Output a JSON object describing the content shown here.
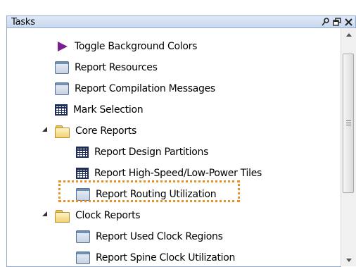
{
  "panel": {
    "title": "Tasks"
  },
  "header_buttons": {
    "pin": "⚲",
    "float": "🗗",
    "close": "✕"
  },
  "tree": {
    "items": [
      {
        "label": "Toggle Background Colors",
        "icon": "play-icon"
      },
      {
        "label": "Report Resources",
        "icon": "window-icon"
      },
      {
        "label": "Report Compilation Messages",
        "icon": "window-icon"
      },
      {
        "label": "Mark Selection",
        "icon": "grid-icon"
      },
      {
        "label": "Core Reports",
        "icon": "folder-icon",
        "expanded": true
      },
      {
        "label": "Report Design Partitions",
        "icon": "grid-icon"
      },
      {
        "label": "Report High-Speed/Low-Power Tiles",
        "icon": "grid-icon"
      },
      {
        "label": "Report Routing Utilization",
        "icon": "window-icon",
        "highlighted": true
      },
      {
        "label": "Clock Reports",
        "icon": "folder-icon",
        "expanded": true
      },
      {
        "label": "Report Used Clock Regions",
        "icon": "window-icon"
      },
      {
        "label": "Report Spine Clock Utilization",
        "icon": "window-icon"
      }
    ]
  },
  "colors": {
    "highlight_border": "#e8912a",
    "header_bg": "#c9d9ef",
    "toggle_icon": "#7a1f8f"
  }
}
